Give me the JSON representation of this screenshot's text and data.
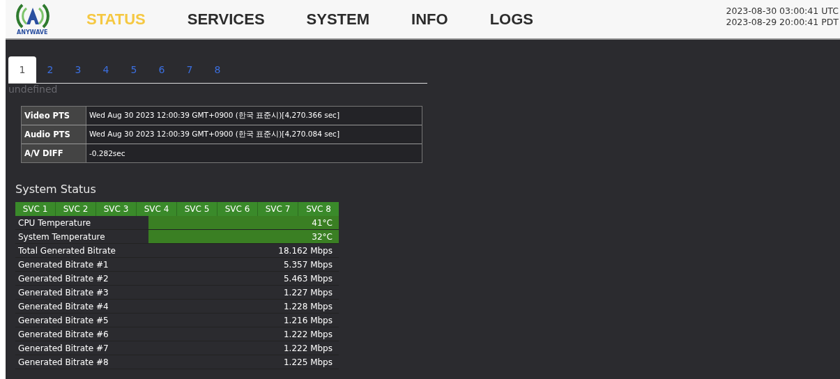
{
  "header": {
    "logo_text": "ANYWAVE",
    "nav": [
      {
        "label": "STATUS",
        "selected": true
      },
      {
        "label": "SERVICES",
        "selected": false
      },
      {
        "label": "SYSTEM",
        "selected": false
      },
      {
        "label": "INFO",
        "selected": false
      },
      {
        "label": "LOGS",
        "selected": false
      }
    ],
    "clock": [
      "2023-08-30 03:00:41 UTC",
      "2023-08-29 20:00:41 PDT"
    ]
  },
  "tabs": [
    {
      "label": "1",
      "selected": true
    },
    {
      "label": "2",
      "selected": false
    },
    {
      "label": "3",
      "selected": false
    },
    {
      "label": "4",
      "selected": false
    },
    {
      "label": "5",
      "selected": false
    },
    {
      "label": "6",
      "selected": false
    },
    {
      "label": "7",
      "selected": false
    },
    {
      "label": "8",
      "selected": false
    }
  ],
  "tab_caption": "undefined",
  "pts_table": [
    {
      "label": "Video PTS",
      "value": "Wed Aug 30 2023 12:00:39 GMT+0900 (한국 표준시)[4,270.366 sec]"
    },
    {
      "label": "Audio PTS",
      "value": "Wed Aug 30 2023 12:00:39 GMT+0900 (한국 표준시)[4,270.084 sec]"
    },
    {
      "label": "A/V DIFF",
      "value": "-0.282sec"
    }
  ],
  "system_status": {
    "title": "System Status",
    "columns": [
      "SVC 1",
      "SVC 2",
      "SVC 3",
      "SVC 4",
      "SVC 5",
      "SVC 6",
      "SVC 7",
      "SVC 8"
    ],
    "rows": [
      {
        "label": "CPU Temperature",
        "value": "41°C",
        "kind": "bar"
      },
      {
        "label": "System Temperature",
        "value": "32°C",
        "kind": "bar"
      },
      {
        "label": "Total Generated Bitrate",
        "value": "18.162 Mbps",
        "kind": "plain"
      },
      {
        "label": "Generated Bitrate #1",
        "value": "5.357 Mbps",
        "kind": "plain"
      },
      {
        "label": "Generated Bitrate #2",
        "value": "5.463 Mbps",
        "kind": "plain"
      },
      {
        "label": "Generated Bitrate #3",
        "value": "1.227 Mbps",
        "kind": "plain"
      },
      {
        "label": "Generated Bitrate #4",
        "value": "1.228 Mbps",
        "kind": "plain"
      },
      {
        "label": "Generated Bitrate #5",
        "value": "1.216 Mbps",
        "kind": "plain"
      },
      {
        "label": "Generated Bitrate #6",
        "value": "1.222 Mbps",
        "kind": "plain"
      },
      {
        "label": "Generated Bitrate #7",
        "value": "1.222 Mbps",
        "kind": "plain"
      },
      {
        "label": "Generated Bitrate #8",
        "value": "1.225 Mbps",
        "kind": "plain"
      }
    ]
  }
}
